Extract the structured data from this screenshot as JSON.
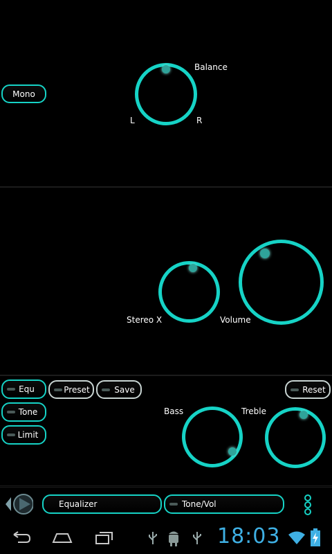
{
  "balance_panel": {
    "mono_label": "Mono",
    "balance_label": "Balance",
    "left_label": "L",
    "right_label": "R"
  },
  "stereo_panel": {
    "stereox_label": "Stereo X",
    "volume_label": "Volume"
  },
  "tone_panel": {
    "equ_label": "Equ",
    "tone_label": "Tone",
    "limit_label": "Limit",
    "preset_label": "Preset",
    "save_label": "Save",
    "reset_label": "Reset",
    "bass_label": "Bass",
    "treble_label": "Treble"
  },
  "bottom_bar": {
    "equalizer_label": "Equalizer",
    "tonevol_label": "Tone/Vol"
  },
  "status_bar": {
    "time": "18:03"
  },
  "colors": {
    "accent": "#16d3c6",
    "clock": "#3fb0e4"
  },
  "icons": [
    "back-icon",
    "home-icon",
    "recent-apps-icon",
    "usb-icon",
    "android-debug-icon",
    "wifi-icon",
    "battery-charging-icon",
    "play-arrow-icon",
    "menu-dots-icon"
  ]
}
